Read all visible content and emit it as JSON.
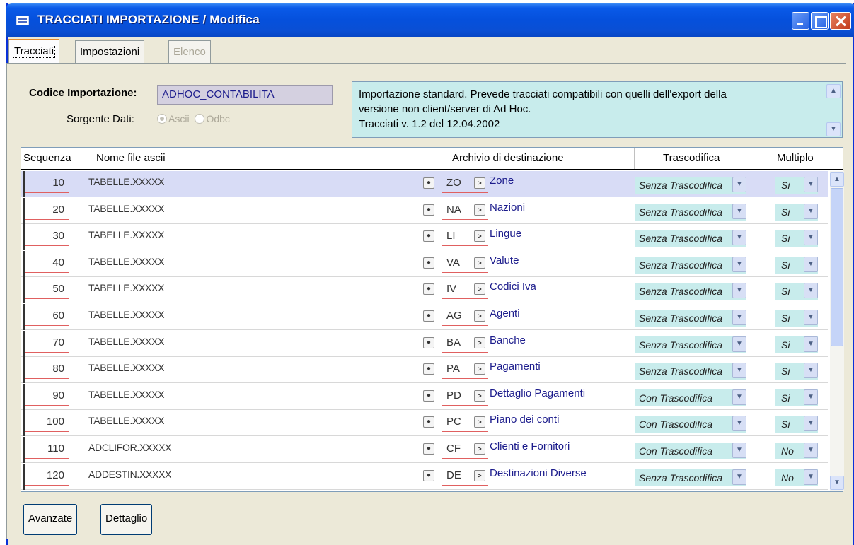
{
  "window": {
    "title": "TRACCIATI IMPORTAZIONE / Modifica",
    "tabs": [
      {
        "label": "Tracciati",
        "active": true
      },
      {
        "label": "Impostazioni",
        "active": false
      },
      {
        "label": "Elenco",
        "disabled": true
      }
    ]
  },
  "form": {
    "codice_label": "Codice Importazione:",
    "codice_value": "ADHOC_CONTABILITA",
    "sorgente_label": "Sorgente Dati:",
    "sorgente_options": [
      "Ascii",
      "Odbc"
    ],
    "sorgente_selected": "Ascii",
    "description_lines": [
      "Importazione standard. Prevede tracciati compatibili con quelli dell'export della",
      "versione non client/server di Ad Hoc.",
      "Tracciati v. 1.2 del 12.04.2002"
    ]
  },
  "grid": {
    "headers": {
      "sequenza": "Sequenza",
      "nome": "Nome file ascii",
      "archivio": "Archivio di destinazione",
      "trascodifica": "Trascodifica",
      "multiplo": "Multiplo"
    },
    "rows": [
      {
        "seq": "10",
        "nome": "TABELLE.XXXXX",
        "code": "ZO",
        "archivio": "Zone",
        "trasc": "Senza Trascodifica",
        "mult": "Si"
      },
      {
        "seq": "20",
        "nome": "TABELLE.XXXXX",
        "code": "NA",
        "archivio": "Nazioni",
        "trasc": "Senza Trascodifica",
        "mult": "Si"
      },
      {
        "seq": "30",
        "nome": "TABELLE.XXXXX",
        "code": "LI",
        "archivio": "Lingue",
        "trasc": "Senza Trascodifica",
        "mult": "Si"
      },
      {
        "seq": "40",
        "nome": "TABELLE.XXXXX",
        "code": "VA",
        "archivio": "Valute",
        "trasc": "Senza Trascodifica",
        "mult": "Si"
      },
      {
        "seq": "50",
        "nome": "TABELLE.XXXXX",
        "code": "IV",
        "archivio": "Codici Iva",
        "trasc": "Senza Trascodifica",
        "mult": "Si"
      },
      {
        "seq": "60",
        "nome": "TABELLE.XXXXX",
        "code": "AG",
        "archivio": "Agenti",
        "trasc": "Senza Trascodifica",
        "mult": "Si"
      },
      {
        "seq": "70",
        "nome": "TABELLE.XXXXX",
        "code": "BA",
        "archivio": "Banche",
        "trasc": "Senza Trascodifica",
        "mult": "Si"
      },
      {
        "seq": "80",
        "nome": "TABELLE.XXXXX",
        "code": "PA",
        "archivio": "Pagamenti",
        "trasc": "Senza Trascodifica",
        "mult": "Si"
      },
      {
        "seq": "90",
        "nome": "TABELLE.XXXXX",
        "code": "PD",
        "archivio": "Dettaglio Pagamenti",
        "trasc": "Con Trascodifica",
        "mult": "Si"
      },
      {
        "seq": "100",
        "nome": "TABELLE.XXXXX",
        "code": "PC",
        "archivio": "Piano dei conti",
        "trasc": "Con Trascodifica",
        "mult": "Si"
      },
      {
        "seq": "110",
        "nome": "ADCLIFOR.XXXXX",
        "code": "CF",
        "archivio": "Clienti e Fornitori",
        "trasc": "Con Trascodifica",
        "mult": "No"
      },
      {
        "seq": "120",
        "nome": "ADDESTIN.XXXXX",
        "code": "DE",
        "archivio": "Destinazioni Diverse",
        "trasc": "Senza Trascodifica",
        "mult": "No"
      }
    ],
    "selected_row": 0
  },
  "buttons": {
    "avanzate": "Avanzate",
    "dettaglio": "Dettaglio"
  },
  "colors": {
    "titlebar": "#0550dc",
    "field_cyan": "#c8ecec",
    "selected_row": "#d8dcf6",
    "required_red": "#e06060"
  }
}
